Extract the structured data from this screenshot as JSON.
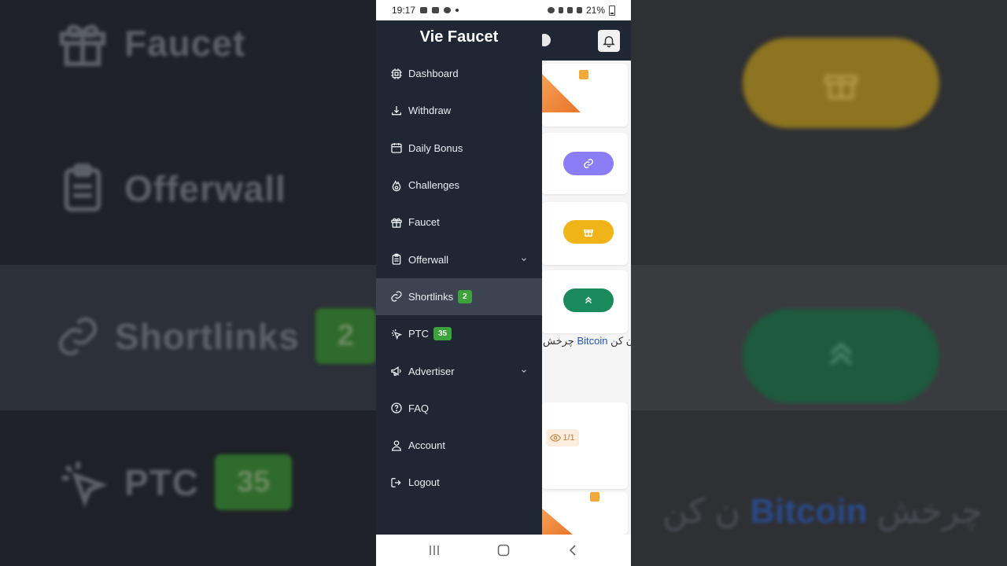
{
  "background": {
    "left_items": [
      {
        "label": "Faucet",
        "icon": "gift-icon"
      },
      {
        "label": "Offerwall",
        "icon": "clipboard-icon"
      },
      {
        "label": "Shortlinks",
        "icon": "link-icon",
        "badge": "2"
      },
      {
        "label": "PTC",
        "icon": "cursor-click-icon",
        "badge": "35"
      }
    ],
    "right_text_rtl": "ن کن",
    "right_text_link": "Bitcoin",
    "right_text_tail": "چرخش"
  },
  "statusbar": {
    "time": "19:17",
    "battery": "21%"
  },
  "page": {
    "rtl_prefix": "ن کن",
    "rtl_link": "Bitcoin",
    "rtl_suffix": "چرخش",
    "views": "1/1",
    "colors": {
      "purple": "#8b7df5",
      "yellow": "#f0b418",
      "green": "#1a8a5a"
    }
  },
  "drawer": {
    "brand": "Vie Faucet",
    "items": [
      {
        "label": "Dashboard",
        "icon": "chip-icon"
      },
      {
        "label": "Withdraw",
        "icon": "download-icon"
      },
      {
        "label": "Daily Bonus",
        "icon": "calendar-icon"
      },
      {
        "label": "Challenges",
        "icon": "fire-icon"
      },
      {
        "label": "Faucet",
        "icon": "gift-icon"
      },
      {
        "label": "Offerwall",
        "icon": "clipboard-icon",
        "has_dropdown": true
      },
      {
        "label": "Shortlinks",
        "icon": "link-icon",
        "badge": "2",
        "active": true
      },
      {
        "label": "PTC",
        "icon": "cursor-click-icon",
        "badge": "35"
      },
      {
        "label": "Advertiser",
        "icon": "megaphone-icon",
        "has_dropdown": true
      },
      {
        "label": "FAQ",
        "icon": "question-icon"
      },
      {
        "label": "Account",
        "icon": "user-icon"
      },
      {
        "label": "Logout",
        "icon": "logout-icon"
      }
    ],
    "colors": {
      "background": "#1e2733",
      "active": "#3c4452",
      "badge": "#3ca33a"
    }
  },
  "navbar": {
    "buttons": [
      "recent-apps-icon",
      "home-icon",
      "back-icon"
    ]
  }
}
